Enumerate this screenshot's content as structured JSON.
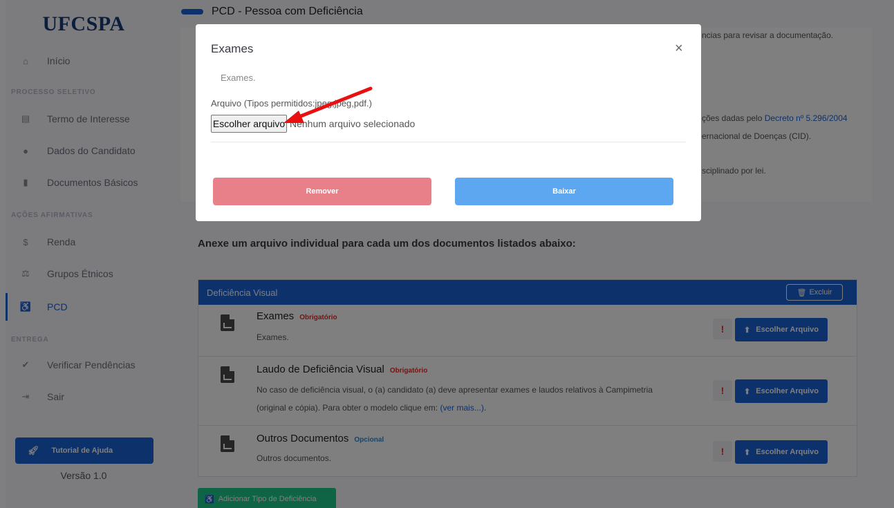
{
  "sidebar": {
    "logo": "UFCSPA",
    "home": "Início",
    "sections": {
      "processo": "PROCESSO SELETIVO",
      "acoes": "AÇÕES AFIRMATIVAS",
      "entrega": "ENTREGA"
    },
    "items": {
      "termo": "Termo de Interesse",
      "dados": "Dados do Candidato",
      "documentos": "Documentos Básicos",
      "renda": "Renda",
      "grupos": "Grupos Étnicos",
      "pcd": "PCD",
      "verificar": "Verificar Pendências",
      "sair": "Sair"
    },
    "tutorial": "Tutorial de Ajuda",
    "version": "Versão 1.0"
  },
  "main": {
    "header": "PCD - Pessoa com Deficiência",
    "info_line1": "ncias para revisar a documentação.",
    "info_line2_prefix": "ções dadas pelo ",
    "info_line2_link": "Decreto nº 5.296/2004",
    "info_line3": "ernacional de Doenças (CID).",
    "info_line4": "sciplinado por lei.",
    "instruction": "Anexe um arquivo individual para cada um dos documentos listados abaixo:",
    "deficiency": {
      "title": "Deficiência Visual",
      "delete_label": "Excluir",
      "docs": [
        {
          "title": "Exames",
          "badge": "Obrigatório",
          "desc": "Exames."
        },
        {
          "title": "Laudo de Deficiência Visual",
          "badge": "Obrigatório",
          "desc1": "No caso de deficiência visual, o (a) candidato (a) deve apresentar exames e laudos relativos à Campimetria",
          "desc2": "(original e cópia). Para obter o modelo clique em: ",
          "link": "(ver mais...)",
          "desc2_end": "."
        },
        {
          "title": "Outros Documentos",
          "badge": "Opcional",
          "desc": "Outros documentos."
        }
      ],
      "alert": "!",
      "choose_label": "Escolher Arquivo"
    },
    "add_type": "Adicionar Tipo de Deficiência"
  },
  "modal": {
    "title": "Exames",
    "close": "×",
    "subtitle": "Exames.",
    "file_label": "Arquivo (Tipos permitidos:jpeg,jpeg,pdf.)",
    "file_button": "Escolher arquivo",
    "file_status": "Nenhum arquivo selecionado",
    "remove": "Remover",
    "download": "Baixar"
  },
  "colors": {
    "primary": "#1a62d6",
    "danger": "#e8808a",
    "info": "#5da6f0",
    "success": "#1cc88a",
    "arrow": "#e81010"
  },
  "icons": {
    "home": "home-icon",
    "print": "print-icon",
    "user": "user-icon",
    "file": "file-icon",
    "dollar": "dollar-icon",
    "balance": "balance-scale-icon",
    "wheelchair": "wheelchair-icon",
    "check": "check-icon",
    "signout": "sign-out-icon",
    "rocket": "rocket-icon",
    "trash": "trash-icon",
    "upload": "upload-icon",
    "image-file": "image-file-icon"
  }
}
